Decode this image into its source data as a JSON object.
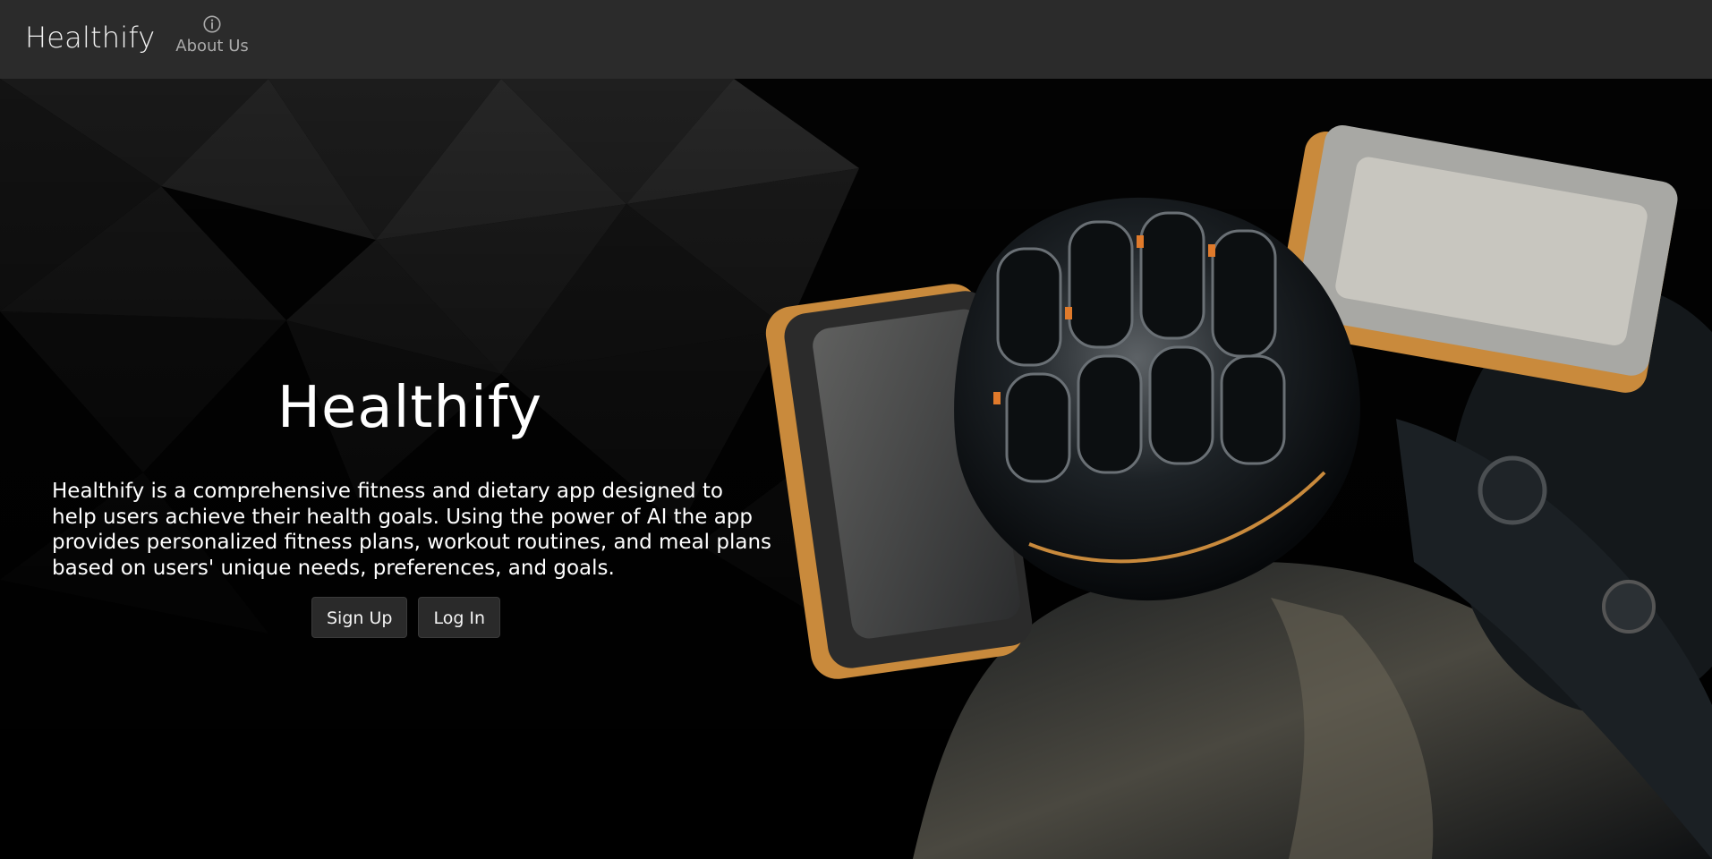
{
  "navbar": {
    "brand": "Healthify",
    "about_label": "About Us",
    "about_icon": "info-circle-icon"
  },
  "hero": {
    "title": "Healthify",
    "description": "Healthify is a comprehensive fitness and dietary app designed to help users achieve their health goals. Using the power of AI the app provides personalized fitness plans, workout routines, and meal plans based on users' unique needs, preferences, and goals.",
    "buttons": {
      "signup": "Sign Up",
      "login": "Log In"
    },
    "image": "robot-fist-dumbbells-image"
  },
  "colors": {
    "navbar_bg": "#2b2b2b",
    "hero_bg": "#030303",
    "button_bg": "#2a2a2a",
    "text": "#ffffff",
    "accent_orange": "#c98a3c"
  }
}
